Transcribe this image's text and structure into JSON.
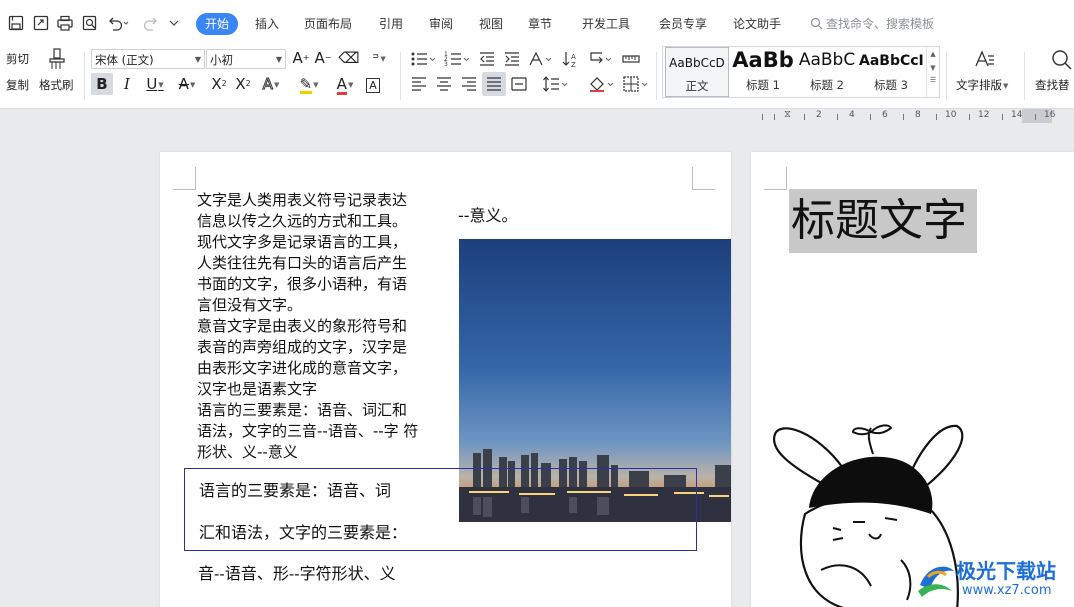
{
  "tabs": [
    "开始",
    "插入",
    "页面布局",
    "引用",
    "审阅",
    "视图",
    "章节",
    "开发工具",
    "会员专享",
    "论文助手"
  ],
  "search_placeholder": "查找命令、搜索模板",
  "ribbon": {
    "cut": "剪切",
    "copy": "复制",
    "format_painter": "格式刷",
    "font_name": "宋体 (正文)",
    "font_size": "小初",
    "styles": [
      {
        "sample": "AaBbCcD",
        "name": "正文"
      },
      {
        "sample": "AaBb",
        "name": "标题 1"
      },
      {
        "sample": "AaBbC",
        "name": "标题 2"
      },
      {
        "sample": "AaBbCcI",
        "name": "标题 3"
      }
    ],
    "text_layout": "文字排版",
    "find_replace": "查找替"
  },
  "ruler": [
    "2",
    "4",
    "6",
    "8",
    "10",
    "12",
    "14",
    "16"
  ],
  "page1": {
    "col1_lines": [
      "文字是人类用表义符号记录表达",
      "信息以传之久远的方式和工具。",
      "现代文字多是记录语言的工具，",
      "人类往往先有口头的语言后产生",
      "书面的文字，很多小语种，有语",
      "言但没有文字。",
      "意音文字是由表义的象形符号和",
      "表音的声旁组成的文字，汉字是",
      "由表形文字进化成的意音文字，",
      "汉字也是语素文字",
      "语言的三要素是：语音、词汇和",
      "语法，文字的三音--语音、--字  符",
      "形状、义--意义"
    ],
    "col2_text": "--意义。",
    "textbox_lines": [
      "语言的三要素是：语音、词",
      "汇和语法，文字的三要素是："
    ],
    "after_text": "音--语音、形--字符形状、义"
  },
  "page2": {
    "title": "标题文字"
  },
  "watermark": {
    "name": "极光下载站",
    "url": "www.xz7.com"
  },
  "colors": {
    "accent": "#3b86f6",
    "textbox_border": "#2b2fa8",
    "title_highlight": "#c8c8c8"
  }
}
